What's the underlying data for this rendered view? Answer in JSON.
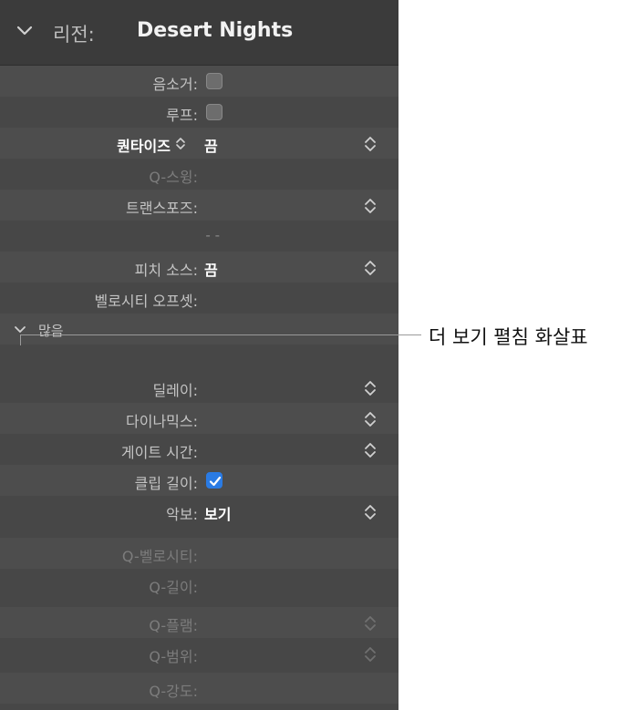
{
  "header": {
    "region_label": "리전:",
    "region_name": "Desert Nights"
  },
  "rows": {
    "mute": {
      "label": "음소거:",
      "checked": false
    },
    "loop": {
      "label": "루프:",
      "checked": false
    },
    "quantize": {
      "label": "퀀타이즈",
      "value": "끔"
    },
    "q_swing": {
      "label": "Q-스윙:"
    },
    "transpose": {
      "label": "트랜스포즈:"
    },
    "dashes": {
      "text": "- -"
    },
    "pitch_source": {
      "label": "피치 소스:",
      "value": "끔"
    },
    "velocity_offset": {
      "label": "벨로시티 오프셋:"
    }
  },
  "more": {
    "label": "많음"
  },
  "more_rows": {
    "delay": {
      "label": "딜레이:"
    },
    "dynamics": {
      "label": "다이나믹스:"
    },
    "gate_time": {
      "label": "게이트 시간:"
    },
    "clip_length": {
      "label": "클립 길이:",
      "checked": true
    },
    "score": {
      "label": "악보:",
      "value": "보기"
    },
    "q_velocity": {
      "label": "Q-벨로시티:"
    },
    "q_length": {
      "label": "Q-길이:"
    },
    "q_flam": {
      "label": "Q-플램:"
    },
    "q_range": {
      "label": "Q-범위:"
    },
    "q_strength": {
      "label": "Q-강도:"
    }
  },
  "callout": {
    "text": "더 보기 펼침 화살표"
  },
  "colors": {
    "panel": "#474747",
    "header": "#3b3b3b",
    "accent": "#2a7be4"
  }
}
